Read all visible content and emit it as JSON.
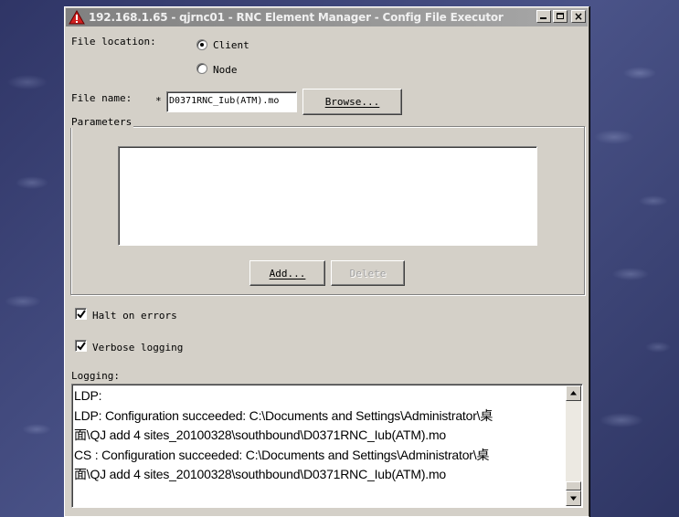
{
  "window": {
    "title": "192.168.1.65 - qjrnc01 - RNC Element Manager - Config File Executor"
  },
  "file_location": {
    "label": "File location:",
    "options": [
      {
        "label": "Client",
        "selected": true
      },
      {
        "label": "Node",
        "selected": false
      }
    ]
  },
  "file_name": {
    "label": "File name:",
    "required_marker": "*",
    "value": "D0371RNC_Iub(ATM).mo",
    "browse_label": "Browse..."
  },
  "parameters": {
    "group_label": "Parameters",
    "add_label": "Add...",
    "delete_label": "Delete"
  },
  "options": {
    "halt_on_errors": {
      "label": "Halt on errors",
      "checked": true
    },
    "verbose_logging": {
      "label": "Verbose logging",
      "checked": true
    }
  },
  "logging": {
    "label": "Logging:",
    "lines": [
      "LDP:",
      "LDP: Configuration succeeded: C:\\Documents and Settings\\Administrator\\桌",
      "面\\QJ add 4 sites_20100328\\southbound\\D0371RNC_Iub(ATM).mo",
      "CS : Configuration succeeded: C:\\Documents and Settings\\Administrator\\桌",
      "面\\QJ add 4 sites_20100328\\southbound\\D0371RNC_Iub(ATM).mo"
    ]
  },
  "colors": {
    "desktop": "#3d4576",
    "dialog": "#d4d0c8",
    "titlebar_inactive": "#a8a8a8",
    "warning_icon": "#d02020"
  },
  "icons": {
    "title": "warning-triangle-icon",
    "minimize": "minimize-icon",
    "maximize": "maximize-icon",
    "close": "close-icon"
  }
}
